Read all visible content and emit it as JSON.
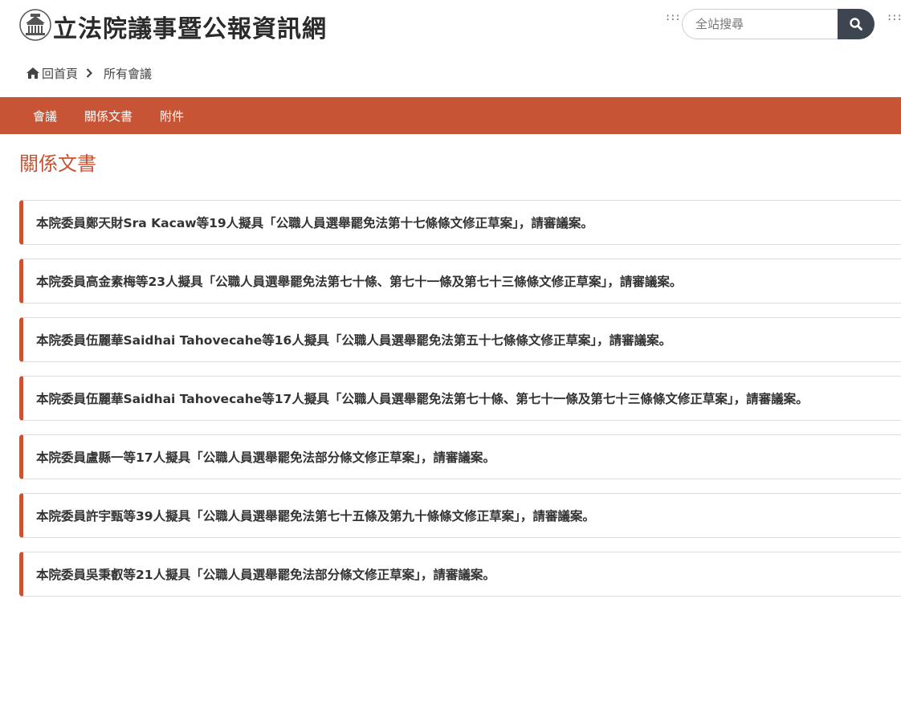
{
  "header": {
    "site_title": "立法院議事暨公報資訊網",
    "logo_icon": "legislative-building-logo",
    "access_key_left": ":::",
    "access_key_right": ":::",
    "search": {
      "placeholder": "全站搜尋",
      "button_icon": "search-icon"
    }
  },
  "breadcrumb": {
    "home_label": "回首頁",
    "home_icon": "home-icon",
    "separator_icon": "chevron-right-icon",
    "current": "所有會議"
  },
  "nav": {
    "items": [
      {
        "label": "會議"
      },
      {
        "label": "關係文書"
      },
      {
        "label": "附件"
      }
    ]
  },
  "main": {
    "section_title": "關係文書",
    "documents": [
      {
        "text": "本院委員鄭天財Sra Kacaw等19人擬具「公職人員選舉罷免法第十七條條文修正草案」，請審議案。"
      },
      {
        "text": "本院委員高金素梅等23人擬具「公職人員選舉罷免法第七十條、第七十一條及第七十三條條文修正草案」，請審議案。"
      },
      {
        "text": "本院委員伍麗華Saidhai Tahovecahe等16人擬具「公職人員選舉罷免法第五十七條條文修正草案」，請審議案。"
      },
      {
        "text": "本院委員伍麗華Saidhai Tahovecahe等17人擬具「公職人員選舉罷免法第七十條、第七十一條及第七十三條條文修正草案」，請審議案。"
      },
      {
        "text": "本院委員盧縣一等17人擬具「公職人員選舉罷免法部分條文修正草案」，請審議案。"
      },
      {
        "text": "本院委員許宇甄等39人擬具「公職人員選舉罷免法第七十五條及第九十條條文修正草案」，請審議案。"
      },
      {
        "text": "本院委員吳秉叡等21人擬具「公職人員選舉罷免法部分條文修正草案」，請審議案。"
      }
    ]
  },
  "colors": {
    "accent": "#c75435",
    "search_button": "#3d4550",
    "border": "#dddddd"
  }
}
